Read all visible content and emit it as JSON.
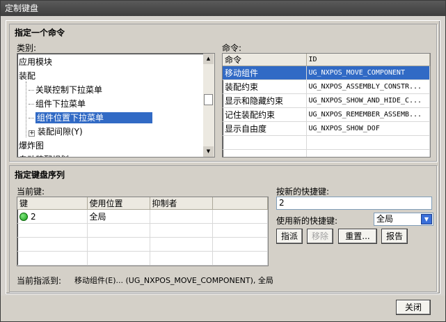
{
  "window": {
    "title": "定制键盘"
  },
  "specify_command": {
    "group_title": "指定一个命令",
    "category_label": "类别:",
    "command_label": "命令:",
    "categories": [
      {
        "label": "应用模块",
        "level": 0,
        "expander": ""
      },
      {
        "label": "装配",
        "level": 0,
        "expander": ""
      },
      {
        "label": "关联控制下拉菜单",
        "level": 1,
        "expander": ""
      },
      {
        "label": "组件下拉菜单",
        "level": 1,
        "expander": ""
      },
      {
        "label": "组件位置下拉菜单",
        "level": 1,
        "expander": "",
        "selected": true
      },
      {
        "label": "装配间隙(Y)",
        "level": 1,
        "expander": "+"
      },
      {
        "label": "爆炸图",
        "level": 0,
        "expander": ""
      },
      {
        "label": "自动装配规划",
        "level": 0,
        "expander": ""
      }
    ],
    "command_columns": [
      "命令",
      "ID"
    ],
    "commands": [
      {
        "name": "移动组件",
        "id": "UG_NXPOS_MOVE_COMPONENT",
        "selected": true
      },
      {
        "name": "装配约束",
        "id": "UG_NXPOS_ASSEMBLY_CONSTR..."
      },
      {
        "name": "显示和隐藏约束",
        "id": "UG_NXPOS_SHOW_AND_HIDE_C..."
      },
      {
        "name": "记住装配约束",
        "id": "UG_NXPOS_REMEMBER_ASSEMB..."
      },
      {
        "name": "显示自由度",
        "id": "UG_NXPOS_SHOW_DOF"
      }
    ]
  },
  "key_sequence": {
    "group_title": "指定键盘序列",
    "current_keys_label": "当前键:",
    "key_columns": [
      "键",
      "使用位置",
      "抑制者"
    ],
    "keys": [
      {
        "key": "2",
        "location": "全局",
        "suppressor": "",
        "status_color": "#1a9e1a"
      }
    ],
    "new_shortcut_label": "按新的快捷键:",
    "new_shortcut_value": "2",
    "use_new_label": "使用新的快捷键:",
    "use_new_value": "全局",
    "buttons": {
      "assign": "指派",
      "remove": "移除",
      "reset": "重置...",
      "report": "报告"
    },
    "assigned_label": "当前指派到:",
    "assigned_value": "移动组件(E)... (UG_NXPOS_MOVE_COMPONENT), 全局"
  },
  "footer": {
    "close": "关闭"
  }
}
